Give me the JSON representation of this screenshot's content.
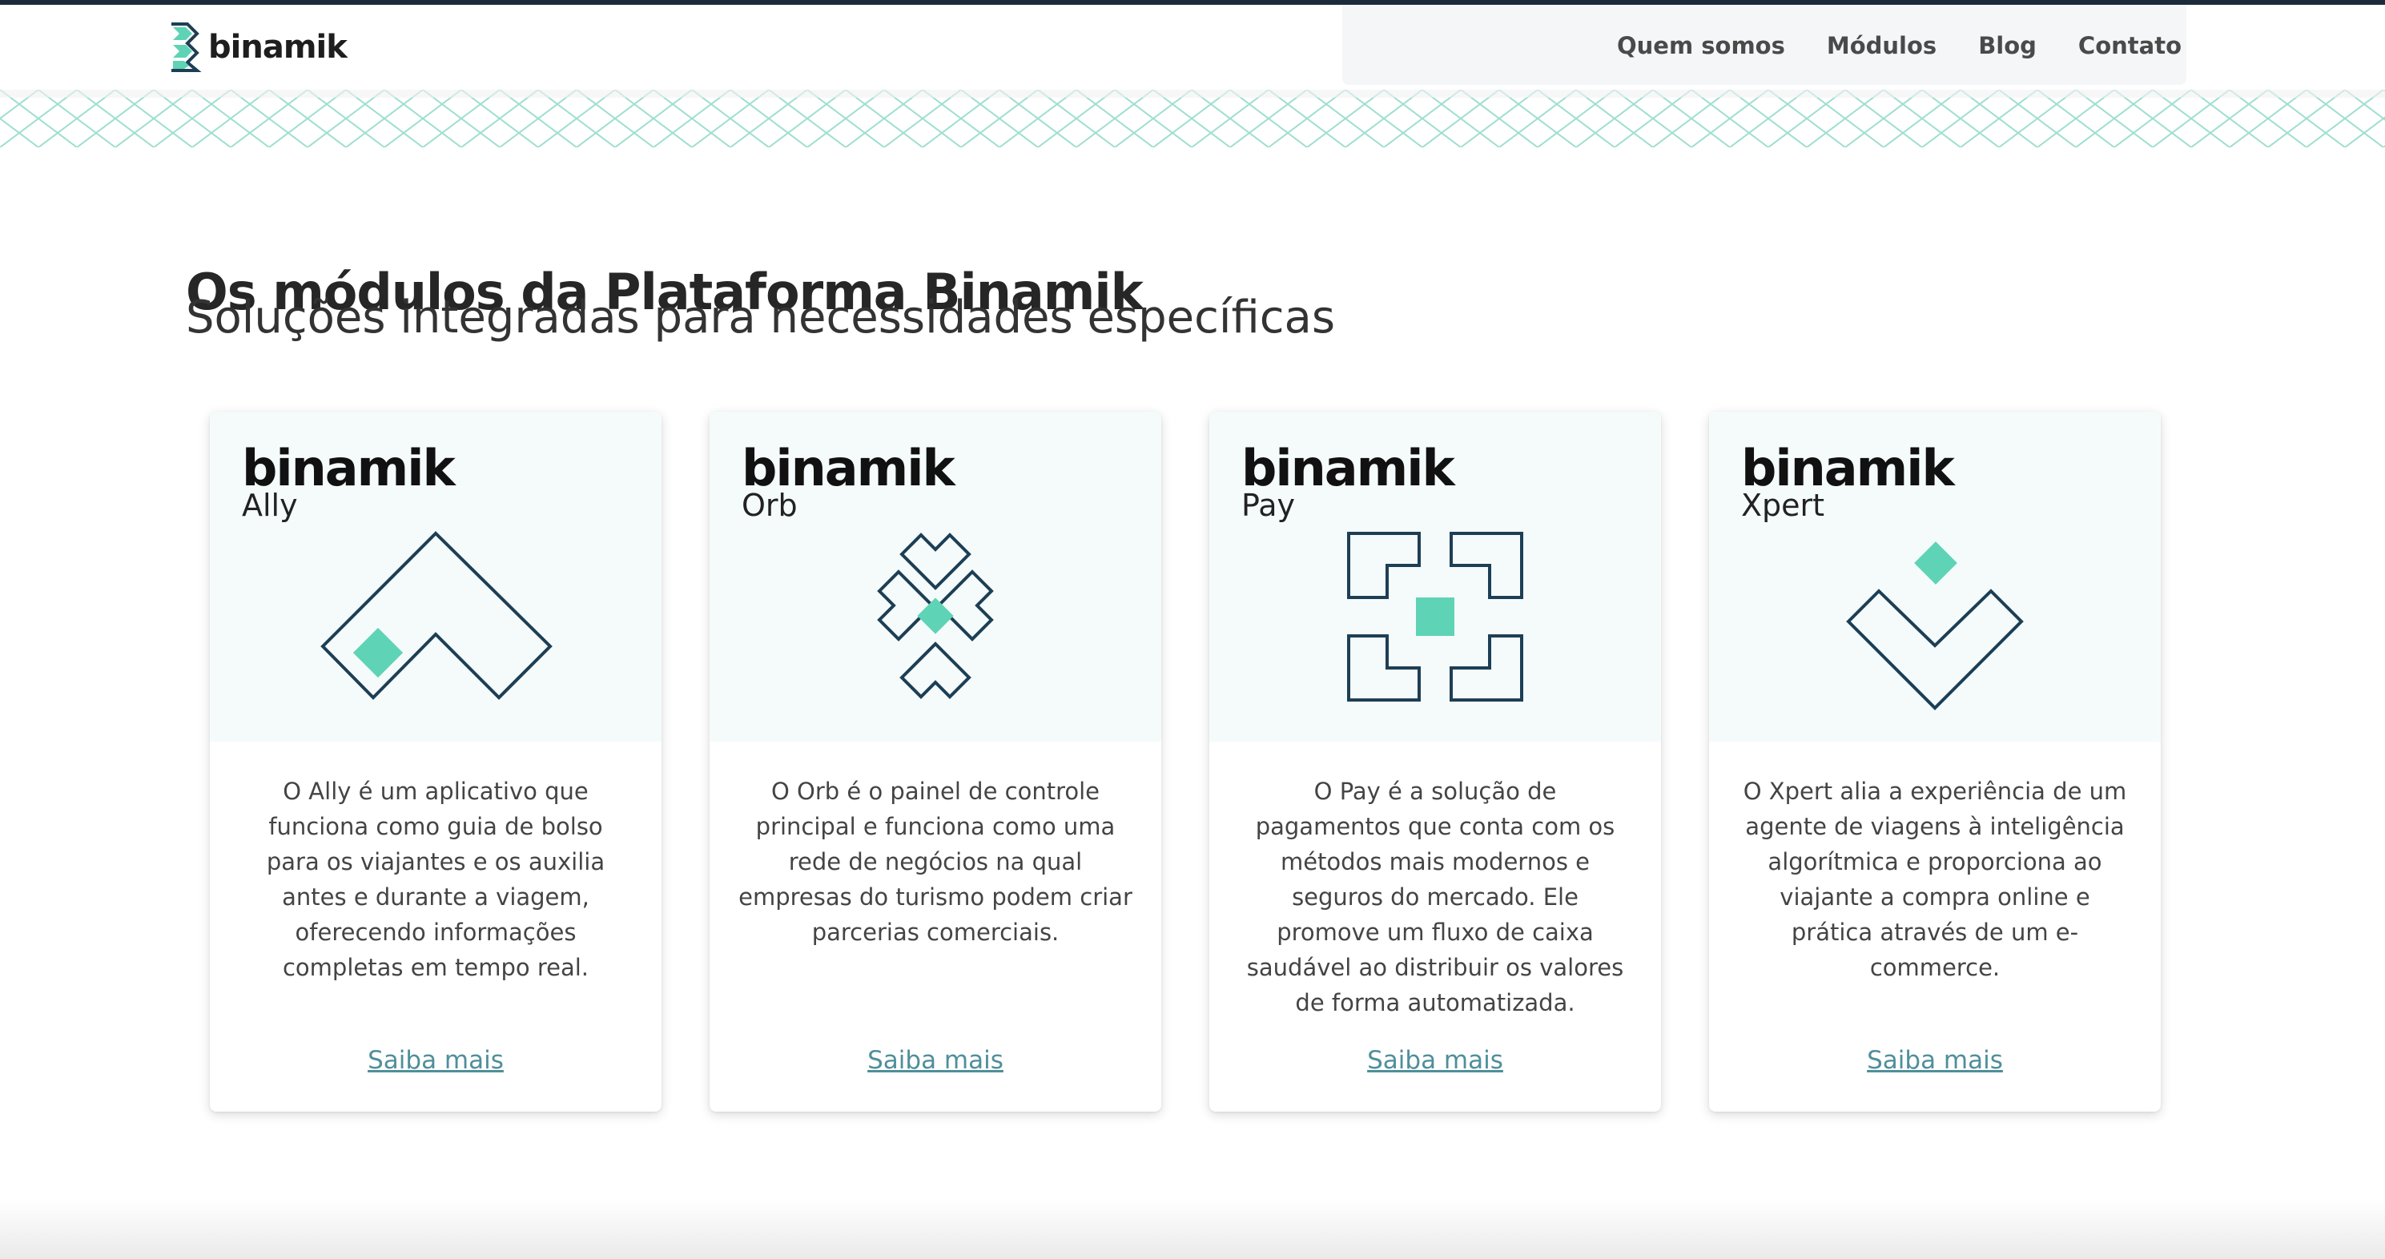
{
  "brand": {
    "logo_text": "binamik"
  },
  "nav": {
    "items": [
      "Quem somos",
      "Módulos",
      "Blog",
      "Contato"
    ]
  },
  "hero": {
    "title": "Os módulos da Plataforma Binamik",
    "subtitle": "Soluções integradas para necessidades específicas"
  },
  "colors": {
    "accent": "#5fd3b6",
    "navy": "#1d3f55",
    "link": "#4f8f9a",
    "card_top_bg": "#f5fbfb"
  },
  "cards": [
    {
      "brand": "binamik",
      "product": "Ally",
      "icon": "ally-icon",
      "description": "O Ally é um aplicativo que funciona como guia de bolso para os viajantes e os auxilia antes e durante a viagem, oferecendo informações completas em tempo real.",
      "link": "Saiba mais"
    },
    {
      "brand": "binamik",
      "product": "Orb",
      "icon": "orb-icon",
      "description": "O Orb é o painel de controle principal e funciona como uma rede de negócios na qual empresas do turismo podem criar parcerias comerciais.",
      "link": "Saiba mais"
    },
    {
      "brand": "binamik",
      "product": "Pay",
      "icon": "pay-icon",
      "description": "O Pay é a solução de pagamentos que conta com os métodos mais modernos e seguros do mercado. Ele promove um fluxo de caixa saudável ao distribuir os valores de forma automatizada.",
      "link": "Saiba mais"
    },
    {
      "brand": "binamik",
      "product": "Xpert",
      "icon": "xpert-icon",
      "description": "O Xpert alia a experiência de um agente de viagens à inteligência algorítmica e proporciona ao viajante a compra online e prática através de um e-commerce.",
      "link": "Saiba mais"
    }
  ]
}
